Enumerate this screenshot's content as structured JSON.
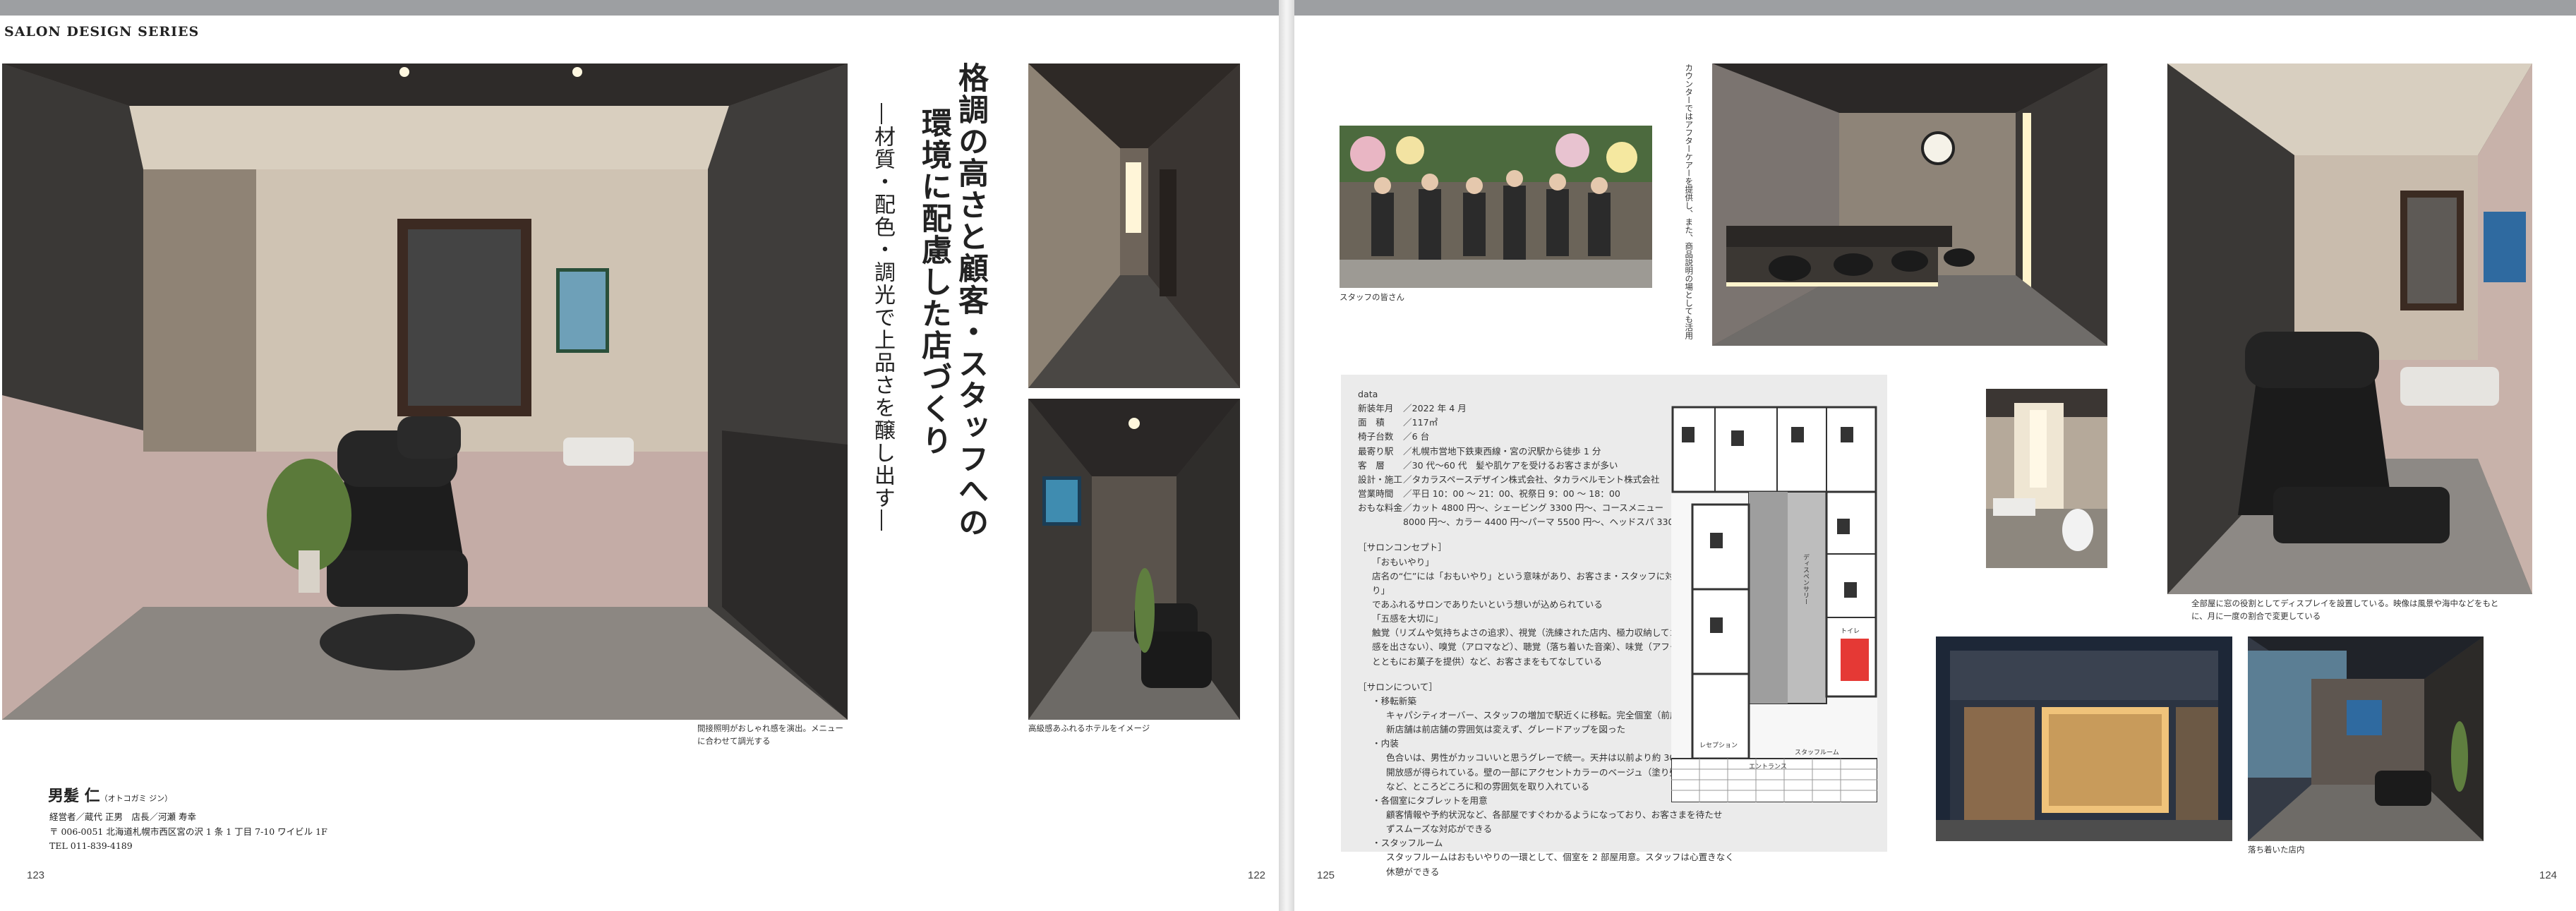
{
  "series": "SALON DESIGN SERIES",
  "headline": {
    "title1": "格調の高さと顧客・スタッフへの",
    "title2": "環境に配慮した店づくり",
    "subtitle": "―材質・配色・調光で上品さを醸し出す―"
  },
  "captions": {
    "main_photo": "間接照明がおしゃれ感を演出。メニューに合わせて調光する",
    "lounge_photo": "高級感あふれるホテルをイメージ",
    "staff_photo": "スタッフの皆さん",
    "counter_photo": "カウンターではアフターケアーを提供し、また、商品説明の場としても活用",
    "shampoo_photo": "全部屋に窓の役割としてディスプレイを設置している。映像は風景や海中などをもとに、月に一度の割合で変更している",
    "exterior_photo": "落ち着いた店内"
  },
  "salon": {
    "name": "男髪 仁",
    "reading": "（オトコガミ ジン）",
    "manager": "経営者／蔵代 正男　店長／河瀬 寿幸",
    "address": "〒 006-0051 北海道札幌市西区宮の沢 1 条 1 丁目 7-10 ワイビル 1F",
    "tel": "TEL 011-839-4189"
  },
  "data_box": {
    "label": "data",
    "rows": [
      {
        "k": "新装年月",
        "v": "／2022 年 4 月"
      },
      {
        "k": "面　積",
        "v": "／117㎡"
      },
      {
        "k": "椅子台数",
        "v": "／6 台"
      },
      {
        "k": "最寄り駅",
        "v": "／札幌市営地下鉄東西線・宮の沢駅から徒歩 1 分"
      },
      {
        "k": "客　層",
        "v": "／30 代〜60 代　髪や肌ケアを受けるお客さまが多い"
      },
      {
        "k": "設計・施工",
        "v": "／タカラスペースデザイン株式会社、タカラベルモント株式会社"
      },
      {
        "k": "営業時間",
        "v": "／平日 10：00 〜 21：00、祝祭日 9：00 〜 18：00"
      },
      {
        "k": "おもな料金",
        "v": "／カット 4800 円〜、シェービング 3300 円〜、コースメニュー"
      }
    ],
    "price_cont": "8000 円〜、カラー 4400 円〜パーマ 5500 円〜、ヘッドスパ 3300 円〜",
    "concept_head": "［サロンコンセプト］",
    "concept_lines": [
      "「おもいやり」",
      "店名の“仁”には「おもいやり」という意味があり、お客さま・スタッフに対して「おもいやり」",
      "であふれるサロンでありたいという想いが込められている",
      "「五感を大切に」",
      "触覚（リズムや気持ちよさの追求）、視覚（洗練された店内、極力収納してゴチャゴチャ",
      "感を出さない）、嗅覚（アロマなど）、聴覚（落ち着いた音楽）、味覚（アフタードリンク",
      "とともにお菓子を提供）など、お客さまをもてなしている"
    ],
    "about_head": "［サロンについて］",
    "about_lines": [
      {
        "t": "・移転新築",
        "c": ""
      },
      {
        "t": "キャパシティオーバー、スタッフの増加で駅近くに移転。完全個室（前店も完全個室）。",
        "c": "ind"
      },
      {
        "t": "新店舗は前店舗の雰囲気は変えず、グレードアップを図った",
        "c": "ind"
      },
      {
        "t": "・内装",
        "c": ""
      },
      {
        "t": "色合いは、男性がカッコいいと思うグレーで統一。天井は以前より約 30cm 高く",
        "c": "ind"
      },
      {
        "t": "開放感が得られている。壁の一部にアクセントカラーのベージュ（塗り壁）を入れる",
        "c": "ind"
      },
      {
        "t": "など、ところどころに和の雰囲気を取り入れている",
        "c": "ind"
      },
      {
        "t": "・各個室にタブレットを用意",
        "c": ""
      },
      {
        "t": "顧客情報や予約状況など、各部屋ですぐわかるようになっており、お客さまを待たせ",
        "c": "ind"
      },
      {
        "t": "ずスムーズな対応ができる",
        "c": "ind"
      },
      {
        "t": "・スタッフルーム",
        "c": ""
      },
      {
        "t": "スタッフルームはおもいやりの一環として、個室を 2 部屋用意。スタッフは心置きなく休憩ができる",
        "c": "ind"
      }
    ]
  },
  "floorplan_labels": {
    "dispensary": "ディスペンサリー",
    "reception": "レセプション",
    "entrance": "エントランス",
    "staff_room": "スタッフルーム",
    "toilet": "トイレ"
  },
  "page_numbers": {
    "left_outer": "123",
    "left_inner": "122",
    "right_inner": "125",
    "right_outer": "124"
  },
  "colors": {
    "top_bar": "#9d9fa2",
    "data_bg": "#ebebeb"
  }
}
